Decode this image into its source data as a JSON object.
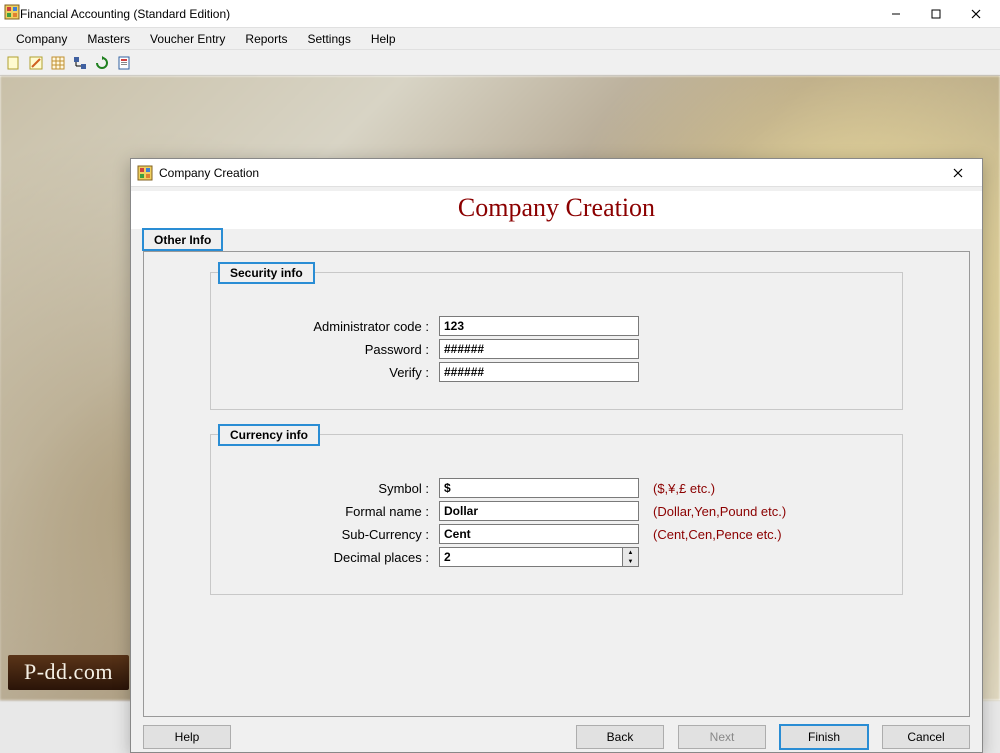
{
  "window": {
    "title": "Financial Accounting (Standard Edition)"
  },
  "menu": {
    "items": [
      "Company",
      "Masters",
      "Voucher Entry",
      "Reports",
      "Settings",
      "Help"
    ]
  },
  "toolbar_icons": [
    "new-file-icon",
    "edit-icon",
    "grid-icon",
    "tree-icon",
    "refresh-icon",
    "report-icon"
  ],
  "dialog": {
    "title": "Company Creation",
    "heading": "Company Creation",
    "tab_label": "Other Info",
    "security_group": {
      "legend": "Security info",
      "admin_label": "Administrator code :",
      "admin_value": "123",
      "password_label": "Password :",
      "password_value": "######",
      "verify_label": "Verify :",
      "verify_value": "######"
    },
    "currency_group": {
      "legend": "Currency info",
      "symbol_label": "Symbol :",
      "symbol_value": "$",
      "symbol_hint": "($,¥,£ etc.)",
      "formal_label": "Formal name :",
      "formal_value": "Dollar",
      "formal_hint": "(Dollar,Yen,Pound etc.)",
      "sub_label": "Sub-Currency :",
      "sub_value": "Cent",
      "sub_hint": "(Cent,Cen,Pence etc.)",
      "decimal_label": "Decimal places :",
      "decimal_value": "2"
    },
    "buttons": {
      "help": "Help",
      "back": "Back",
      "next": "Next",
      "finish": "Finish",
      "cancel": "Cancel"
    }
  },
  "watermark": "P-dd.com"
}
